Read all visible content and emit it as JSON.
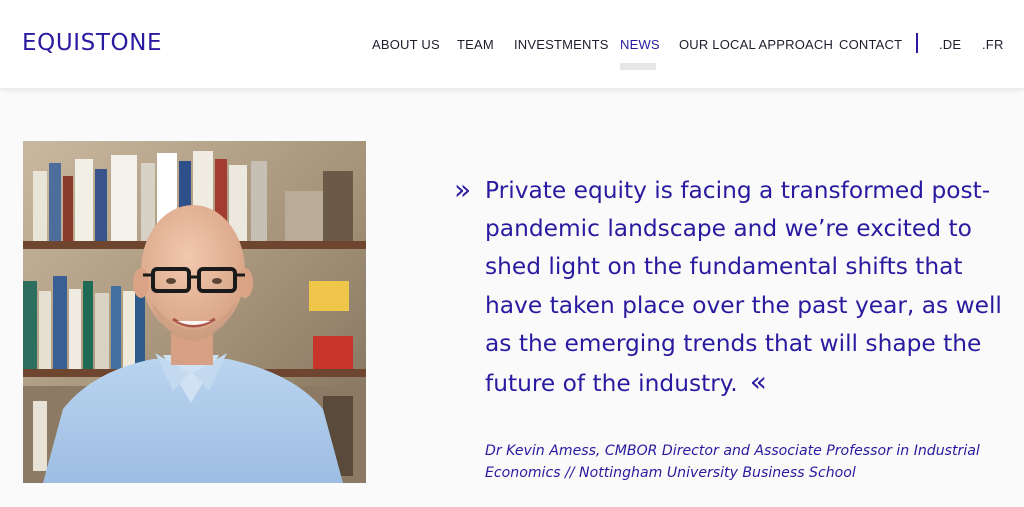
{
  "header": {
    "logo": "EQUISTONE",
    "nav": [
      {
        "label": "ABOUT US"
      },
      {
        "label": "TEAM"
      },
      {
        "label": "INVESTMENTS"
      },
      {
        "label": "NEWS"
      },
      {
        "label": "OUR LOCAL APPROACH"
      },
      {
        "label": "CONTACT"
      }
    ],
    "languages": [
      ".DE",
      ".FR"
    ]
  },
  "quote": {
    "open_mark": "»",
    "close_mark": "«",
    "lines": [
      "Private equity is facing a transformed post-",
      "pandemic landscape and we’re excited to",
      "shed light on the fundamental shifts that",
      "have taken place over the past year, as well",
      "as the emerging trends that will shape the",
      "future of the industry."
    ],
    "author_lines": [
      "Dr Kevin Amess, CMBOR Director and Associate Professor in Industrial",
      "Economics // Nottingham University Business School"
    ]
  },
  "colors": {
    "brand": "#2a1aa0",
    "nav_text": "#1e1e2d",
    "background": "#fafafa"
  }
}
